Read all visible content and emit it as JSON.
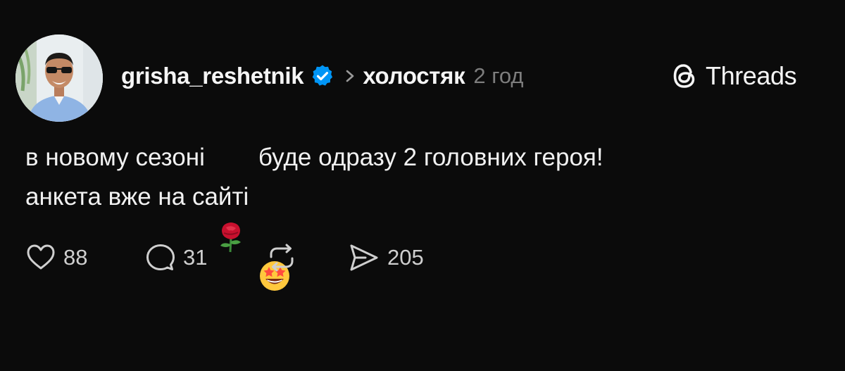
{
  "post": {
    "author": {
      "username": "grisha_reshetnik",
      "verified": true,
      "avatar": "avatar-man-sunglasses"
    },
    "community": "холостяк",
    "time": "2 год",
    "brand": {
      "name": "Threads",
      "icon": "threads-logo-icon"
    },
    "text": {
      "line1_part1": "в новому сезоні",
      "line1_emoji": "rose-emoji",
      "line1_part2": "буде одразу 2 головних героя!",
      "line2_part1": "анкета вже на сайті",
      "line2_emoji": "star-struck-emoji"
    },
    "actions": {
      "likes": "88",
      "comments": "31",
      "shares": "205"
    }
  },
  "colors": {
    "background": "#0b0b0b",
    "text": "#f3f3f3",
    "muted": "#7d7d7d",
    "verified": "#0095f6"
  }
}
